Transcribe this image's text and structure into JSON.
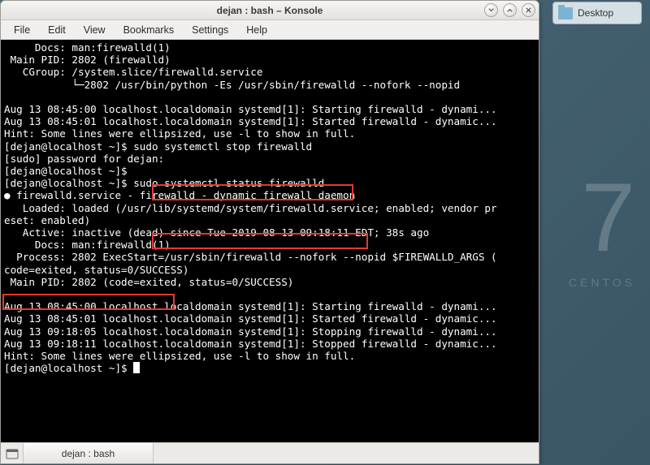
{
  "desktop": {
    "widget_label": "Desktop",
    "bg_number": "7",
    "bg_text": "CENTOS"
  },
  "window": {
    "title": "dejan : bash – Konsole",
    "menu": {
      "file": "File",
      "edit": "Edit",
      "view": "View",
      "bookmarks": "Bookmarks",
      "settings": "Settings",
      "help": "Help"
    },
    "tab_label": "dejan : bash"
  },
  "term": {
    "l01": "     Docs: man:firewalld(1)",
    "l02": " Main PID: 2802 (firewalld)",
    "l03": "   CGroup: /system.slice/firewalld.service",
    "l04": "           └─2802 /usr/bin/python -Es /usr/sbin/firewalld --nofork --nopid",
    "l05": "",
    "l06": "Aug 13 08:45:00 localhost.localdomain systemd[1]: Starting firewalld - dynami...",
    "l07": "Aug 13 08:45:01 localhost.localdomain systemd[1]: Started firewalld - dynamic...",
    "l08": "Hint: Some lines were ellipsized, use -l to show in full.",
    "l09": "[dejan@localhost ~]$ sudo systemctl stop firewalld",
    "l10": "[sudo] password for dejan:",
    "l11": "[dejan@localhost ~]$ ",
    "l12": "[dejan@localhost ~]$ sudo systemctl status firewalld",
    "l13": "● firewalld.service - firewalld - dynamic firewall daemon",
    "l14": "   Loaded: loaded (/usr/lib/systemd/system/firewalld.service; enabled; vendor pr",
    "l15": "eset: enabled)",
    "l16": "   Active: inactive (dead) since Tue 2019-08-13 09:18:11 EDT; 38s ago",
    "l17": "     Docs: man:firewalld(1)",
    "l18": "  Process: 2802 ExecStart=/usr/sbin/firewalld --nofork --nopid $FIREWALLD_ARGS (",
    "l19": "code=exited, status=0/SUCCESS)",
    "l20": " Main PID: 2802 (code=exited, status=0/SUCCESS)",
    "l21": "",
    "l22": "Aug 13 08:45:00 localhost.localdomain systemd[1]: Starting firewalld - dynami...",
    "l23": "Aug 13 08:45:01 localhost.localdomain systemd[1]: Started firewalld - dynamic...",
    "l24": "Aug 13 09:18:05 localhost.localdomain systemd[1]: Stopping firewalld - dynami...",
    "l25": "Aug 13 09:18:11 localhost.localdomain systemd[1]: Stopped firewalld - dynamic...",
    "l26": "Hint: Some lines were ellipsized, use -l to show in full.",
    "l27": "[dejan@localhost ~]$ "
  }
}
